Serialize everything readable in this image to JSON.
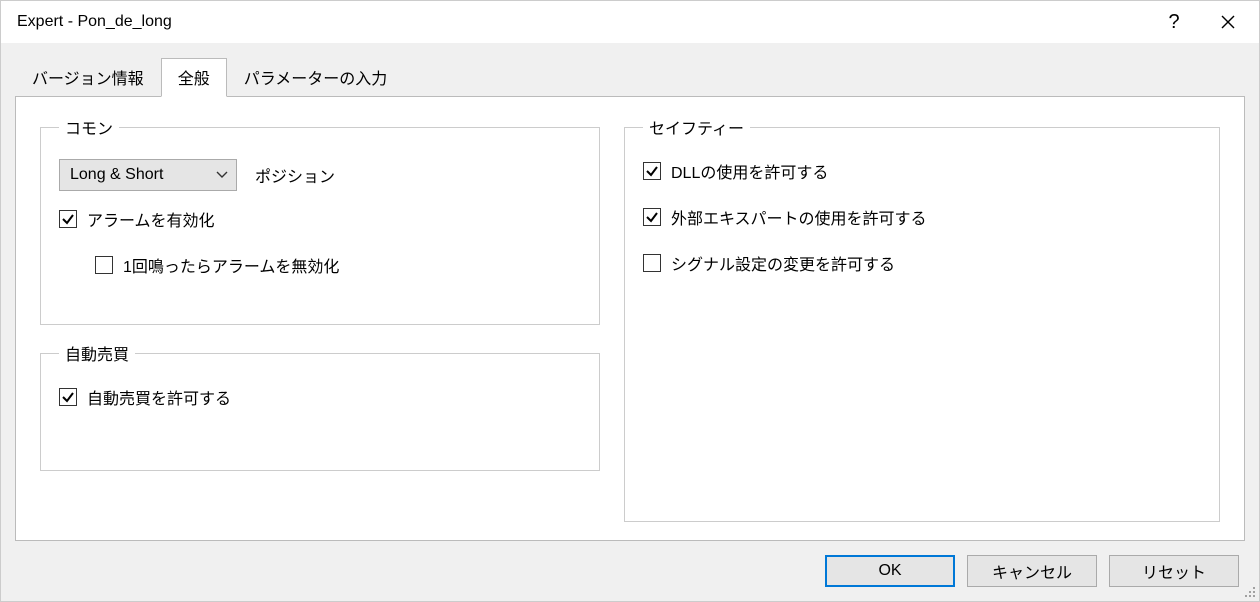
{
  "window": {
    "title": "Expert - Pon_de_long"
  },
  "tabs": {
    "version": "バージョン情報",
    "general": "全般",
    "params": "パラメーターの入力"
  },
  "common": {
    "legend": "コモン",
    "position_selected": "Long & Short",
    "position_label": "ポジション",
    "alarm_enable": "アラームを有効化",
    "alarm_once_disable": "1回鳴ったらアラームを無効化"
  },
  "auto": {
    "legend": "自動売買",
    "allow": "自動売買を許可する"
  },
  "safety": {
    "legend": "セイフティー",
    "allow_dll": "DLLの使用を許可する",
    "allow_ext_expert": "外部エキスパートの使用を許可する",
    "allow_signal_change": "シグナル設定の変更を許可する"
  },
  "buttons": {
    "ok": "OK",
    "cancel": "キャンセル",
    "reset": "リセット"
  }
}
